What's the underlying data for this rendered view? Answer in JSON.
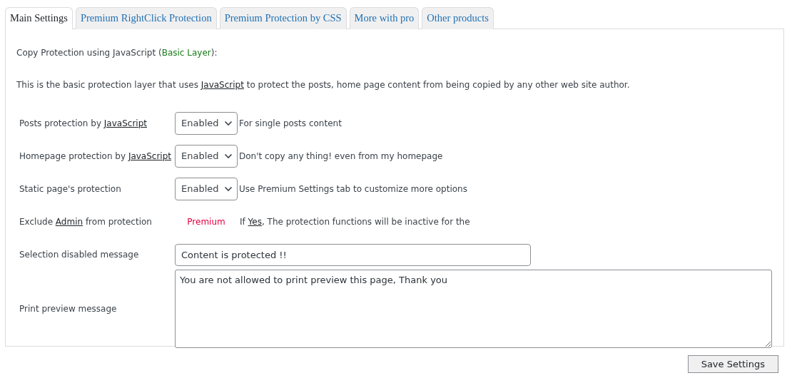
{
  "tabs": [
    {
      "label": "Main Settings",
      "selected": true
    },
    {
      "label": "Premium RightClick Protection",
      "selected": false
    },
    {
      "label": "Premium Protection by CSS",
      "selected": false
    },
    {
      "label": "More with pro",
      "selected": false
    },
    {
      "label": "Other products",
      "selected": false
    }
  ],
  "heading": [
    {
      "kind": "plain",
      "text": "Copy Protection using JavaScript ("
    },
    {
      "kind": "highlight",
      "text": "Basic Layer"
    },
    {
      "kind": "plain",
      "text": "):"
    }
  ],
  "intro": [
    {
      "kind": "plain",
      "text": "This is the basic protection layer that uses "
    },
    {
      "kind": "link",
      "text": "JavaScript"
    },
    {
      "kind": "plain",
      "text": " to protect the posts, home page content from being copied by any other web site author."
    }
  ],
  "settings": [
    {
      "kind": "select",
      "label": [
        {
          "kind": "plain",
          "text": "Posts protection by "
        },
        {
          "kind": "link",
          "text": "JavaScript"
        }
      ],
      "value": "Enabled",
      "note": [
        {
          "kind": "plain",
          "text": "For single posts content"
        }
      ]
    },
    {
      "kind": "select",
      "label": [
        {
          "kind": "plain",
          "text": "Homepage protection by "
        },
        {
          "kind": "link",
          "text": "JavaScript"
        }
      ],
      "value": "Enabled",
      "note": [
        {
          "kind": "plain",
          "text": "Don't copy any thing! even from my homepage"
        }
      ]
    },
    {
      "kind": "select",
      "label": [
        {
          "kind": "plain",
          "text": "Static page's protection"
        }
      ],
      "value": "Enabled",
      "note": [
        {
          "kind": "plain",
          "text": "Use Premium Settings tab to customize more options"
        }
      ]
    },
    {
      "kind": "premium",
      "label": [
        {
          "kind": "plain",
          "text": "Exclude "
        },
        {
          "kind": "link",
          "text": "Admin"
        },
        {
          "kind": "plain",
          "text": " from protection"
        }
      ],
      "value": "Premium",
      "note": [
        {
          "kind": "plain",
          "text": "If "
        },
        {
          "kind": "link",
          "text": "Yes"
        },
        {
          "kind": "plain",
          "text": ", The protection functions will be inactive for the"
        }
      ]
    },
    {
      "kind": "text",
      "label": [
        {
          "kind": "plain",
          "text": "Selection disabled message"
        }
      ],
      "value": "Content is protected !!"
    },
    {
      "kind": "textarea",
      "label": [
        {
          "kind": "plain",
          "text": "Print preview message"
        }
      ],
      "value": "You are not allowed to print preview this page, Thank you"
    }
  ],
  "save_button": "Save Settings"
}
